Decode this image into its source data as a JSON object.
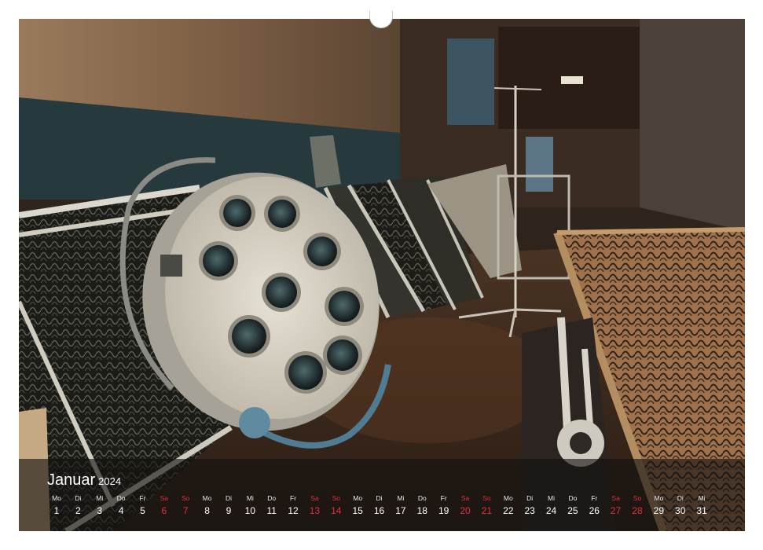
{
  "calendar": {
    "month": "Januar",
    "year": "2024",
    "days": [
      {
        "abbr": "Mo",
        "num": "1"
      },
      {
        "abbr": "Di",
        "num": "2"
      },
      {
        "abbr": "Mi",
        "num": "3"
      },
      {
        "abbr": "Do",
        "num": "4"
      },
      {
        "abbr": "Fr",
        "num": "5"
      },
      {
        "abbr": "Sa",
        "num": "6"
      },
      {
        "abbr": "So",
        "num": "7"
      },
      {
        "abbr": "Mo",
        "num": "8"
      },
      {
        "abbr": "Di",
        "num": "9"
      },
      {
        "abbr": "Mi",
        "num": "10"
      },
      {
        "abbr": "Do",
        "num": "11"
      },
      {
        "abbr": "Fr",
        "num": "12"
      },
      {
        "abbr": "Sa",
        "num": "13"
      },
      {
        "abbr": "So",
        "num": "14"
      },
      {
        "abbr": "Mo",
        "num": "15"
      },
      {
        "abbr": "Di",
        "num": "16"
      },
      {
        "abbr": "Mi",
        "num": "17"
      },
      {
        "abbr": "Do",
        "num": "18"
      },
      {
        "abbr": "Fr",
        "num": "19"
      },
      {
        "abbr": "Sa",
        "num": "20"
      },
      {
        "abbr": "So",
        "num": "21"
      },
      {
        "abbr": "Mo",
        "num": "22"
      },
      {
        "abbr": "Di",
        "num": "23"
      },
      {
        "abbr": "Mi",
        "num": "24"
      },
      {
        "abbr": "Do",
        "num": "25"
      },
      {
        "abbr": "Fr",
        "num": "26"
      },
      {
        "abbr": "Sa",
        "num": "27"
      },
      {
        "abbr": "So",
        "num": "28"
      },
      {
        "abbr": "Mo",
        "num": "29"
      },
      {
        "abbr": "Di",
        "num": "30"
      },
      {
        "abbr": "Mi",
        "num": "31"
      }
    ],
    "weekend_color": "#e0303a",
    "text_color": "#ffffff"
  },
  "photo": {
    "subject": "abandoned hospital room with surgical operating lamp and bed frames",
    "palette": [
      "#8a6a4e",
      "#2c4348",
      "#d9d3c4",
      "#3a2a1f"
    ]
  }
}
